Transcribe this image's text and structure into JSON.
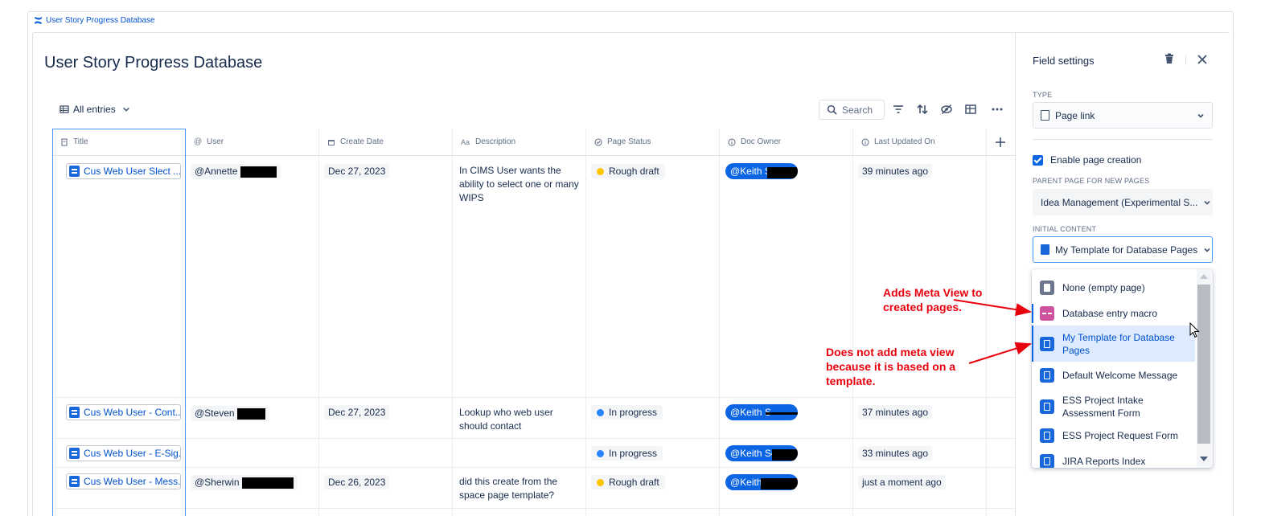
{
  "breadcrumb": {
    "label": "User Story Progress Database"
  },
  "database": {
    "title": "User Story Progress Database",
    "view_label": "All entries"
  },
  "toolbar": {
    "search_label": "Search"
  },
  "columns": [
    {
      "label": "Title",
      "icon": "page-icon"
    },
    {
      "label": "User",
      "icon": "at-icon"
    },
    {
      "label": "Create Date",
      "icon": "calendar-icon"
    },
    {
      "label": "Description",
      "icon": "text-icon"
    },
    {
      "label": "Page Status",
      "icon": "status-icon"
    },
    {
      "label": "Doc Owner",
      "icon": "info-icon"
    },
    {
      "label": "Last Updated On",
      "icon": "info-icon"
    }
  ],
  "rows": [
    {
      "title": "Cus Web User Slect ...",
      "user": "@Annette",
      "create_date": "Dec 27, 2023",
      "description": "In CIMS User wants the ability to select one or many WIPS",
      "status": "Rough draft",
      "status_color": "#ffc400",
      "owner": "@Keith S",
      "updated": "39 minutes ago"
    },
    {
      "title": "Cus Web User - Cont...",
      "user": "@Steven",
      "create_date": "Dec 27, 2023",
      "description": "Lookup who web user should contact",
      "status": "In progress",
      "status_color": "#2684ff",
      "owner": "@Keith S",
      "updated": "37 minutes ago"
    },
    {
      "title": "Cus Web User - E-Sig...",
      "user": "",
      "create_date": "",
      "description": "",
      "status": "In progress",
      "status_color": "#2684ff",
      "owner": "@Keith Sc",
      "updated": "33 minutes ago"
    },
    {
      "title": "Cus Web User - Mess...",
      "user": "@Sherwin",
      "create_date": "Dec 26, 2023",
      "description": "did this create from the space page template?",
      "status": "Rough draft",
      "status_color": "#ffc400",
      "owner": "@Keith",
      "updated": "just a moment ago"
    }
  ],
  "panel": {
    "title": "Field settings",
    "type_label": "TYPE",
    "type_value": "Page link",
    "enable_label": "Enable page creation",
    "parent_label": "PARENT PAGE FOR NEW PAGES",
    "parent_value": "Idea Management (Experimental S...",
    "initial_label": "INITIAL CONTENT",
    "initial_value": "My Template for Database Pages"
  },
  "dropdown_options": [
    {
      "label": "None (empty page)",
      "icon": "gray"
    },
    {
      "label": "Database entry macro",
      "icon": "pink"
    },
    {
      "label": "My Template for Database Pages",
      "icon": "blue"
    },
    {
      "label": "Default Welcome Message",
      "icon": "blue"
    },
    {
      "label": "ESS Project Intake Assessment Form",
      "icon": "blue"
    },
    {
      "label": "ESS Project Request Form",
      "icon": "blue"
    },
    {
      "label": "JIRA Reports Index",
      "icon": "blue"
    }
  ],
  "annotations": {
    "meta_view_1": "Adds Meta View to",
    "meta_view_2": "created pages.",
    "no_meta_1": "Does not add meta view",
    "no_meta_2": "because it is based on a",
    "no_meta_3": "template."
  },
  "colors": {
    "accent": "#0c66e4",
    "annotation": "#e8000d",
    "selection": "#deebff"
  }
}
